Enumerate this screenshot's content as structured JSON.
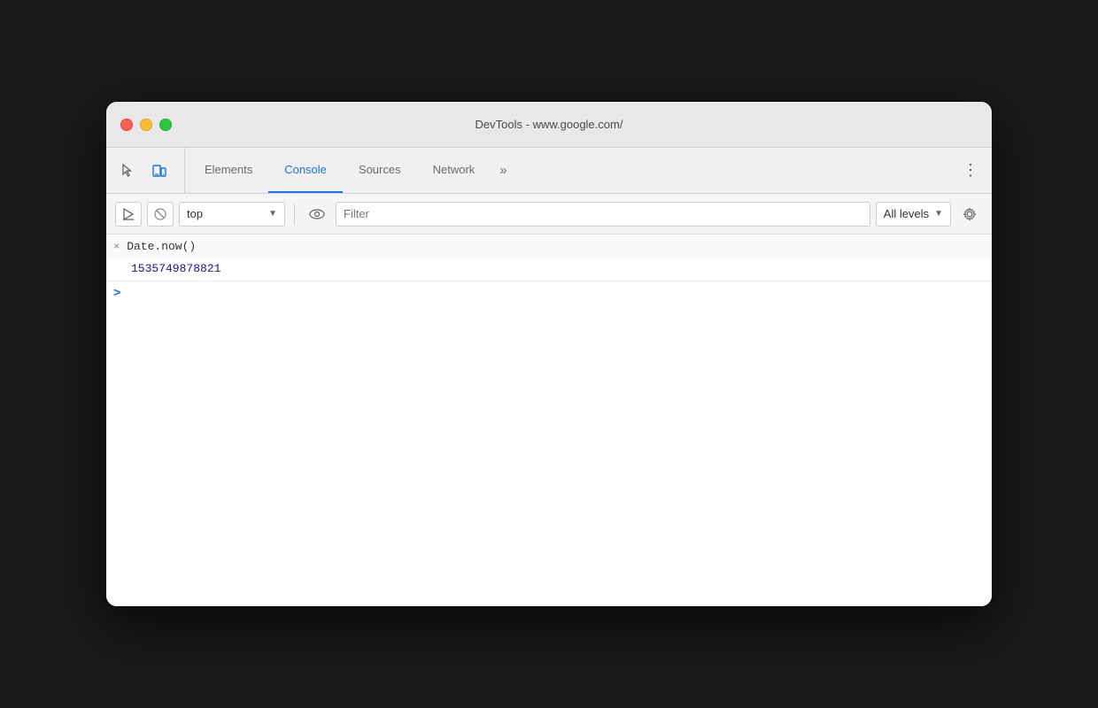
{
  "window": {
    "title": "DevTools - www.google.com/"
  },
  "traffic_lights": {
    "close_label": "",
    "minimize_label": "",
    "maximize_label": ""
  },
  "tabs": {
    "items": [
      {
        "id": "elements",
        "label": "Elements",
        "active": false
      },
      {
        "id": "console",
        "label": "Console",
        "active": true
      },
      {
        "id": "sources",
        "label": "Sources",
        "active": false
      },
      {
        "id": "network",
        "label": "Network",
        "active": false
      }
    ],
    "more_label": "»",
    "three_dots_label": "⋮"
  },
  "toolbar": {
    "execute_label": "▶",
    "clear_label": "🚫",
    "context_value": "top",
    "context_arrow": "▼",
    "filter_placeholder": "Filter",
    "levels_label": "All levels",
    "levels_arrow": "▼"
  },
  "console": {
    "entry": {
      "icon": "×",
      "input_code": "Date.now()",
      "output_value": "1535749878821"
    },
    "prompt_symbol": ">",
    "cursor_value": ""
  }
}
